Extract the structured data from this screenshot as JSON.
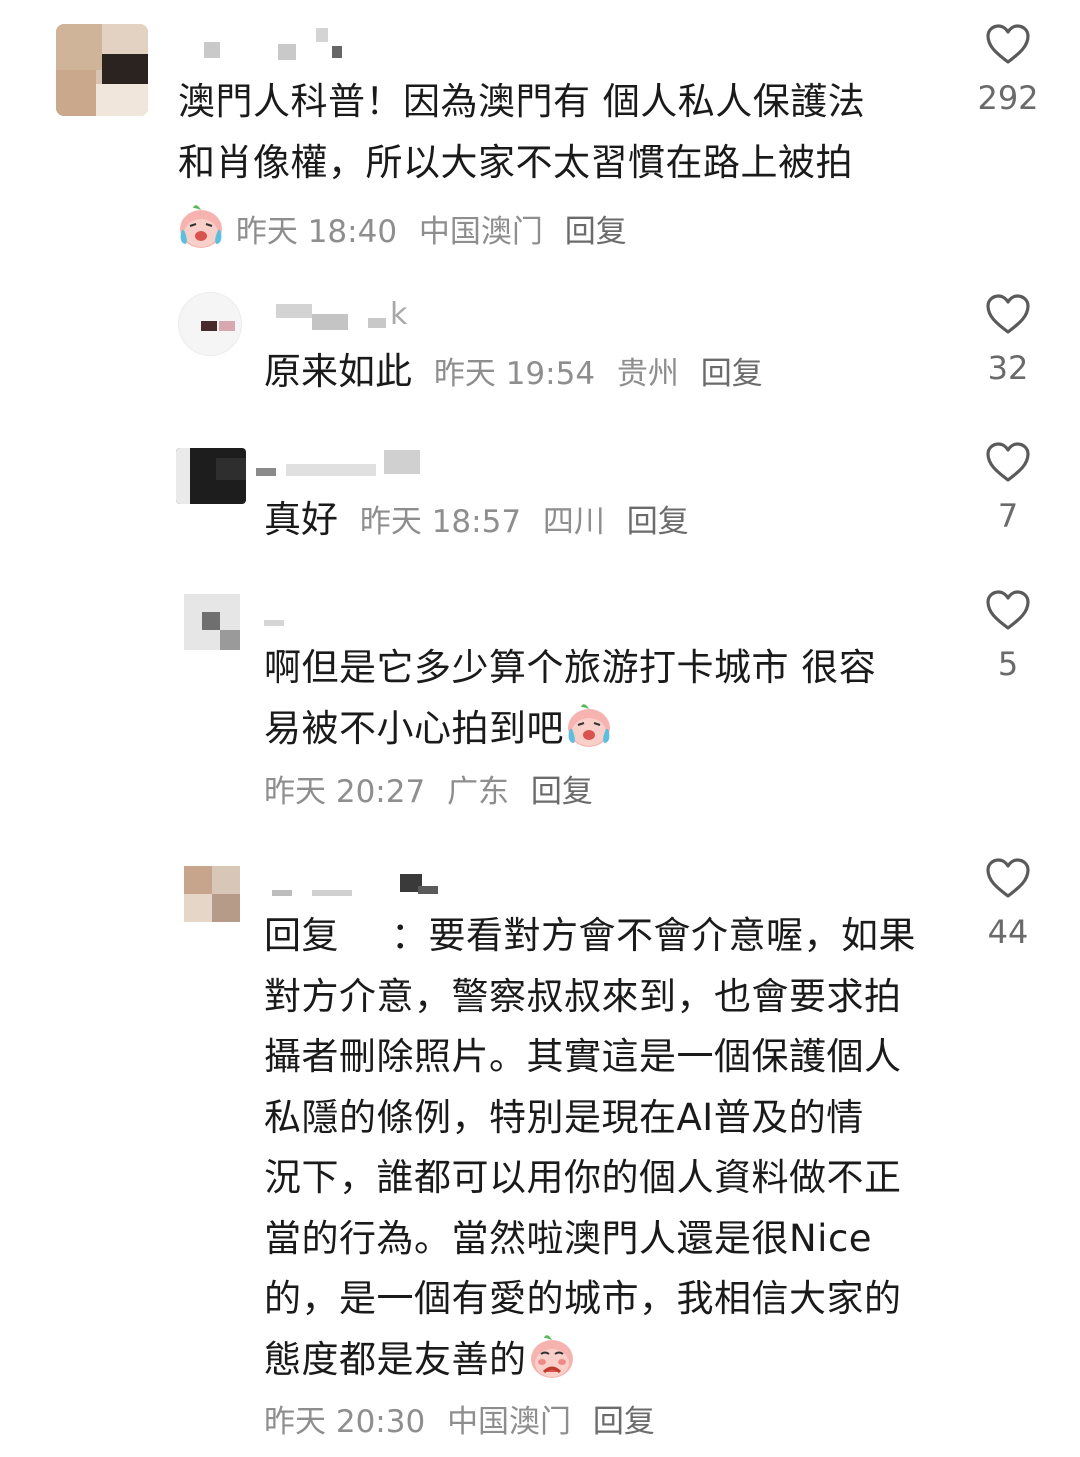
{
  "comments": [
    {
      "text_lines": [
        "澳門人科普！因為澳門有 個人私人保護法",
        "和肖像權，所以大家不太習慣在路上被拍"
      ],
      "time": "昨天 18:40",
      "location": "中国澳门",
      "reply": "回复",
      "likes": "292"
    },
    {
      "name_tail": "k",
      "text": "原来如此",
      "time": "昨天 19:54",
      "location": "贵州",
      "reply": "回复",
      "likes": "32"
    },
    {
      "text": "真好",
      "time": "昨天 18:57",
      "location": "四川",
      "reply": "回复",
      "likes": "7"
    },
    {
      "text_lines": [
        "啊但是它多少算个旅游打卡城市 很容",
        "易被不小心拍到吧"
      ],
      "time": "昨天 20:27",
      "location": "广东",
      "reply": "回复",
      "likes": "5"
    },
    {
      "reply_prefix": "回复",
      "text_lines": [
        "：要看對方會不會介意喔，如果",
        "對方介意，警察叔叔來到，也會要求拍",
        "攝者刪除照片。其實這是一個保護個人",
        "私隱的條例，特別是現在AI普及的情",
        "況下，誰都可以用你的個人資料做不正",
        "當的行為。當然啦澳門人還是很Nice",
        "的，是一個有愛的城市，我相信大家的",
        "態度都是友善的"
      ],
      "time": "昨天 20:30",
      "location": "中国澳门",
      "reply": "回复",
      "likes": "44"
    }
  ],
  "icons": {
    "like": "heart-outline-icon",
    "crying_emoji": "crying-peach-emoji",
    "shy_emoji": "shy-peach-emoji"
  },
  "colors": {
    "text": "#1a1a1a",
    "meta": "#8e8e8e",
    "like_icon": "#5a5a5a"
  }
}
